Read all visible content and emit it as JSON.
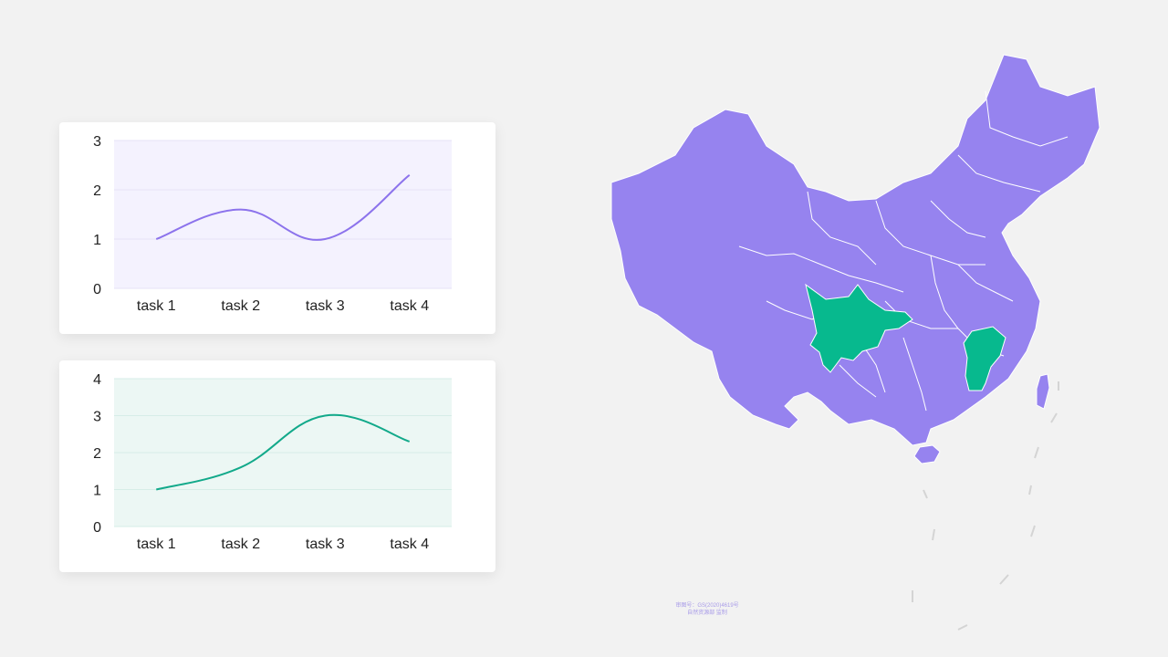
{
  "chart_data": [
    {
      "type": "line",
      "categories": [
        "task 1",
        "task 2",
        "task 3",
        "task 4"
      ],
      "series": [
        {
          "values": [
            1,
            1.6,
            1,
            2.3
          ]
        }
      ],
      "ylim": [
        0,
        3
      ],
      "yticks": [
        0,
        1,
        2,
        3
      ],
      "grid": true,
      "smooth": true,
      "line_color": "#8c73ec",
      "area_color": "#f4f2fe",
      "grid_color": "#e6e2f7"
    },
    {
      "type": "line",
      "categories": [
        "task 1",
        "task 2",
        "task 3",
        "task 4"
      ],
      "series": [
        {
          "values": [
            1,
            1.6,
            3,
            2.3
          ]
        }
      ],
      "ylim": [
        0,
        4
      ],
      "yticks": [
        0,
        1,
        2,
        3,
        4
      ],
      "grid": true,
      "smooth": true,
      "line_color": "#12a98a",
      "area_color": "#ecf7f4",
      "grid_color": "#d6ede7"
    }
  ],
  "map": {
    "base_color": "#9683ef",
    "highlight_color": "#07b98e",
    "highlighted_regions": [
      "sichuan",
      "jiangxi"
    ]
  },
  "footer": {
    "line1": "审图号：GS(2020)4619号",
    "line2": "自然资源部 监制"
  }
}
